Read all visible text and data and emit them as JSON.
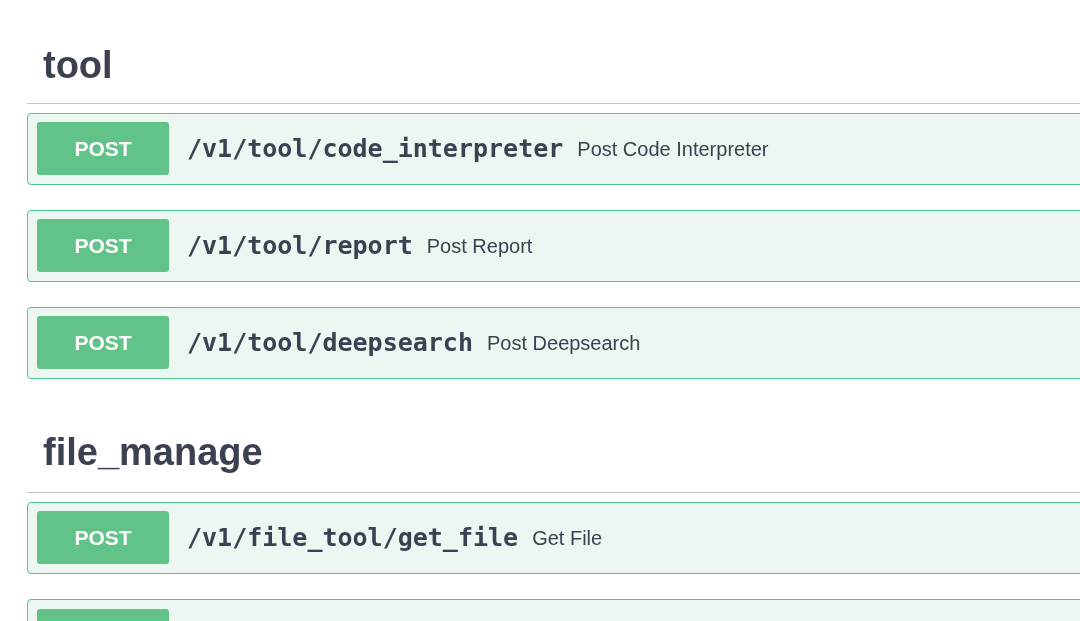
{
  "sections": [
    {
      "title": "tool",
      "operations": [
        {
          "method": "POST",
          "path": "/v1/tool/code_interpreter",
          "summary": "Post Code Interpreter"
        },
        {
          "method": "POST",
          "path": "/v1/tool/report",
          "summary": "Post Report"
        },
        {
          "method": "POST",
          "path": "/v1/tool/deepsearch",
          "summary": "Post Deepsearch"
        }
      ]
    },
    {
      "title": "file_manage",
      "operations": [
        {
          "method": "POST",
          "path": "/v1/file_tool/get_file",
          "summary": "Get File"
        }
      ]
    }
  ]
}
